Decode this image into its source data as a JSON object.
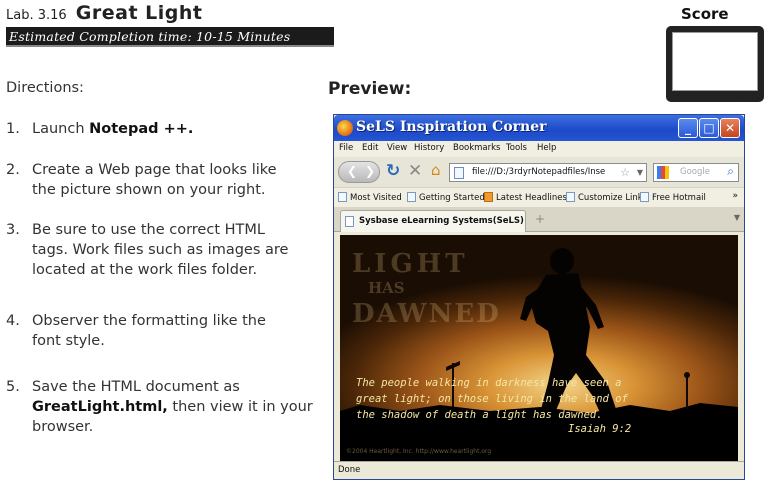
{
  "header": {
    "lab_number": "Lab. 3.16",
    "lab_title": "Great Light",
    "estimated_time": "Estimated Completion time: 10-15 Minutes",
    "score_label": "Score"
  },
  "directions": {
    "label": "Directions:",
    "steps": [
      {
        "num": "1.",
        "pre": "Launch ",
        "bold": "Notepad ++.",
        "post": ""
      },
      {
        "num": "2.",
        "line1": "Create a Web page that looks like",
        "line2": "the picture shown on your right."
      },
      {
        "num": "3.",
        "line1": "Be sure to use the correct HTML",
        "line2": "tags. Work files such as images are",
        "line3": "located at the work files folder."
      },
      {
        "num": "4.",
        "line1": "Observer the formatting like the",
        "line2": "font style."
      },
      {
        "num": "5.",
        "line1": "Save the HTML document as",
        "bold": "GreatLight.html,",
        "line2_post": " then view it in your",
        "line3": "browser."
      }
    ]
  },
  "preview": {
    "label": "Preview:",
    "browser": {
      "title": "SeLS Inspiration Corner",
      "menu": [
        "File",
        "Edit",
        "View",
        "History",
        "Bookmarks",
        "Tools",
        "Help"
      ],
      "url": "file:///D:/3rdyrNotepadfiles/Inse",
      "search_placeholder": "Google",
      "bookmarks": [
        "Most Visited",
        "Getting Started",
        "Latest Headlines",
        "Customize Links",
        "Free Hotmail"
      ],
      "bookmarks_more": "»",
      "tab_title": "Sysbase eLearning Systems(SeLS)",
      "newtab": "+",
      "status": "Done",
      "content": {
        "watermark_1": "LIGHT",
        "watermark_2": "HAS",
        "watermark_3": "DAWNED",
        "verse_line_1": "The people walking in darkness have seen a",
        "verse_line_2": "great light; on those living in the land of",
        "verse_line_3": "the shadow of death a light has dawned.",
        "reference": "Isaiah 9:2",
        "copyright": "©2004 Heartlight, Inc. http://www.heartlight.org"
      }
    }
  }
}
